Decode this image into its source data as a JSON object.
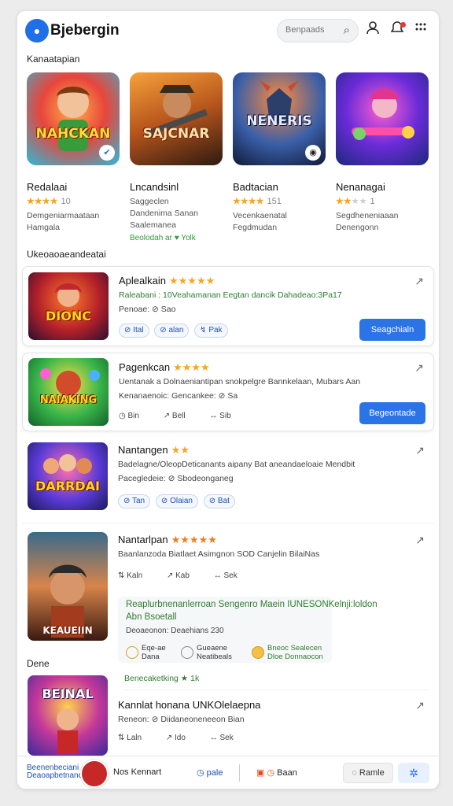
{
  "header": {
    "app_title": "Bjebergin",
    "search_placeholder": "Benpaads",
    "colors": {
      "accent": "#2a74e6",
      "star": "#f5a623"
    }
  },
  "sections": {
    "featured_label": "Kanaatapian",
    "list_label": "Ukeoaoaeandeatai",
    "list_label_2": "Dene"
  },
  "featured": [
    {
      "art_text": "NAHCKAN",
      "name": "Redalaai",
      "stars": "★★★★",
      "rating_count": "10",
      "desc_1": "Demgeniarmaataan",
      "desc_2": "Hamgala",
      "extra": ""
    },
    {
      "art_text": "SAJCNAR",
      "name": "Lncandsinl",
      "stars": "",
      "rating_count": "",
      "desc_1": "Saggeclen",
      "desc_2": "Dandenima Sanan",
      "desc_3": "Saalemanea",
      "extra": "Beolodah ar  ♥  Yolk"
    },
    {
      "art_text": "NENERIS",
      "name": "Badtacian",
      "stars": "★★★★",
      "rating_count": "151",
      "desc_1": "Vecenkaenatal",
      "desc_2": "Fegdmudan",
      "extra": ""
    },
    {
      "art_text": "",
      "name": "Nenanagai",
      "stars": "★★",
      "rating_count": "1",
      "desc_1": "Segdheneniaaan",
      "desc_2": "Denengonn",
      "extra": ""
    }
  ],
  "list": [
    {
      "art_text": "DIONC",
      "title": "Aplealkain",
      "stars": "★★★★★",
      "line_1": "Raleabani : 10Veahamanan Eegtan dancik Dahadeao:3Pa17",
      "line_2": "Penoae:  ⊘ Sao",
      "chips": [
        "Ital",
        "alan",
        "Pak"
      ],
      "button": "Seagchialn"
    },
    {
      "art_text": "NAIAKING",
      "title": "Pagenkcan",
      "stars": "★★★★",
      "line_1": "Uentanak a Dolnaeniantipan snokpelgre Bannkelaan, Mubars Aan",
      "line_2": "Kenanaenoic:  Gencankee:  ⊘ Sa",
      "meta": [
        "Bin",
        "Bell",
        "Sib"
      ],
      "button": "Begeontade"
    },
    {
      "art_text": "DARRDAI",
      "title": "Nantangen",
      "stars": "★★",
      "line_1": "Badelagne/OleopDeticanants aipany Bat aneandaeloaie Mendbit",
      "line_2": "Pacegledeie:  ⊘ Sbodeonganeg",
      "chips": [
        "Tan",
        "Olaian",
        "Bat"
      ]
    },
    {
      "art_text": "KEAUEIIN",
      "title": "Nantarlpan",
      "stars": "★★★★★",
      "line_1": "Baanlanzoda Biatlaet Asimgnon SOD Canjelin BilaiNas",
      "meta": [
        "Kaln",
        "Kab",
        "Sek"
      ]
    }
  ],
  "promo": {
    "title_1": "Reaplurbnenanlerroan Sengenro Maein IUNESONKelnji:loldon",
    "title_2": "Abn Bsoetall",
    "meta": "Deoaeonon:   Deaehians 230",
    "cols": [
      {
        "l1": "Eqe-ae",
        "l2": "Dana"
      },
      {
        "l1": "Gueaene",
        "l2": "Neatibeals"
      },
      {
        "l1": "Bneoc Sealecen",
        "l2": "Dloe Donnaocon"
      }
    ]
  },
  "last_item": {
    "tag": "Benecaketking  ★ 1k",
    "title": "Kannlat honana UNKOlelaepna",
    "line": "Reneon:  ⊘ Diidaneoneneeon Bian",
    "meta": [
      "Laln",
      "Ido",
      "Sek"
    ]
  },
  "bottom": {
    "label_1": "Beenenbeciani",
    "label_2": "Deaoapbetnanc",
    "text_1": "Nos Kennart",
    "text_2": "pale",
    "text_3": "Baan",
    "btn_outline": "Ramle"
  }
}
